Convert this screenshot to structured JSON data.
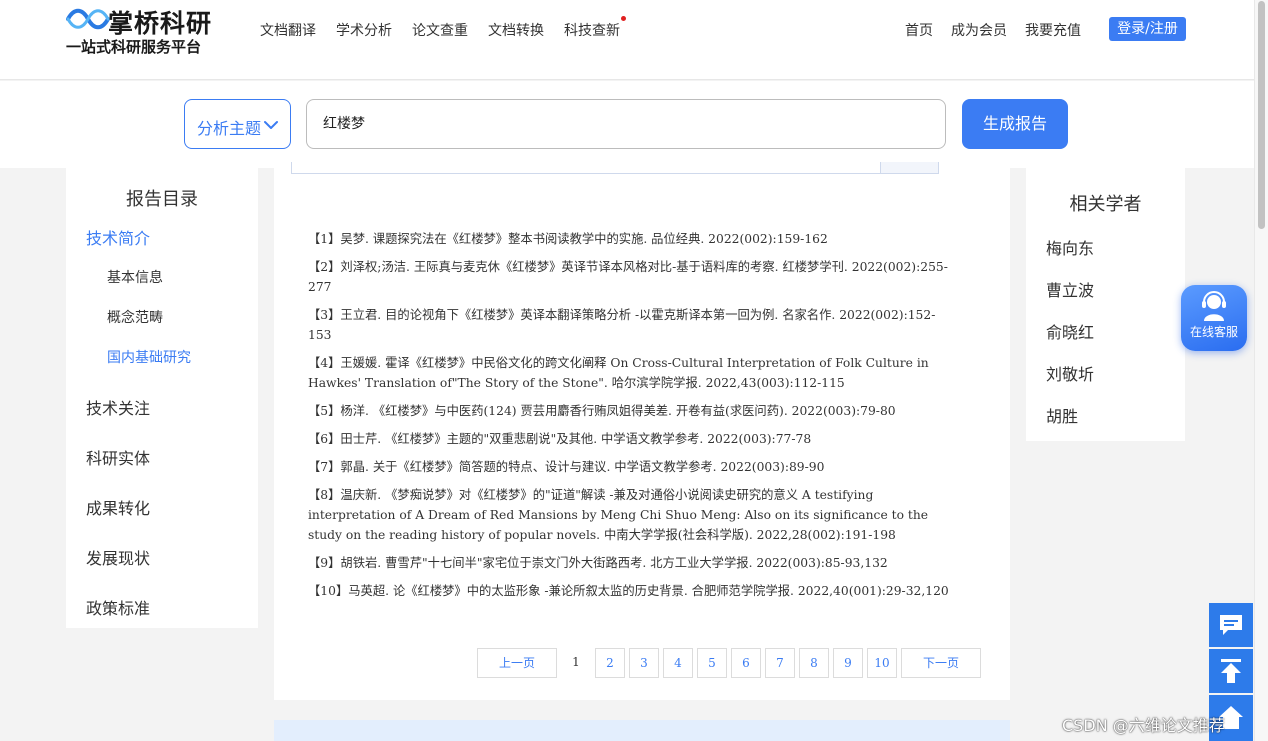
{
  "brand": {
    "name": "掌桥科研",
    "slogan": "一站式科研服务平台"
  },
  "nav": {
    "links": [
      "文档翻译",
      "学术分析",
      "论文查重",
      "文档转换",
      "科技查新"
    ],
    "right_links": [
      "首页",
      "成为会员",
      "我要充值"
    ],
    "login_label": "登录/注册"
  },
  "search": {
    "topic_label": "分析主题",
    "query": "红楼梦",
    "generate_label": "生成报告"
  },
  "toc": {
    "title": "报告目录",
    "items": [
      {
        "label": "技术简介",
        "level": 1,
        "active": true
      },
      {
        "label": "基本信息",
        "level": 2,
        "active": false
      },
      {
        "label": "概念范畴",
        "level": 2,
        "active": false
      },
      {
        "label": "国内基础研究",
        "level": 2,
        "active": true
      },
      {
        "label": "技术关注",
        "level": 1,
        "active": false
      },
      {
        "label": "科研实体",
        "level": 1,
        "active": false
      },
      {
        "label": "成果转化",
        "level": 1,
        "active": false
      },
      {
        "label": "发展现状",
        "level": 1,
        "active": false
      },
      {
        "label": "政策标准",
        "level": 1,
        "active": false
      }
    ]
  },
  "references": [
    "【1】吴梦. 课题探究法在《红楼梦》整本书阅读教学中的实施. 品位经典. 2022(002):159-162",
    "【2】刘泽权;汤洁. 王际真与麦克休《红楼梦》英译节译本风格对比-基于语料库的考察. 红楼梦学刊. 2022(002):255-277",
    "【3】王立君. 目的论视角下《红楼梦》英译本翻译策略分析 -以霍克斯译本第一回为例. 名家名作. 2022(002):152-153",
    "【4】王媛媛. 霍译《红楼梦》中民俗文化的跨文化阐释 On Cross-Cultural Interpretation of Folk Culture in Hawkes' Translation of\"The Story of the Stone\". 哈尔滨学院学报. 2022,43(003):112-115",
    "【5】杨洋. 《红楼梦》与中医药(124) 贾芸用麝香行贿凤姐得美差. 开卷有益(求医问药). 2022(003):79-80",
    "【6】田士芹. 《红楼梦》主题的\"双重悲剧说\"及其他. 中学语文教学参考. 2022(003):77-78",
    "【7】郭晶. 关于《红楼梦》简答题的特点、设计与建议. 中学语文教学参考. 2022(003):89-90",
    "【8】温庆新. 《梦痴说梦》对《红楼梦》的\"证道\"解读 -兼及对通俗小说阅读史研究的意义 A testifying interpretation of A Dream of Red Mansions by Meng Chi Shuo Meng: Also on its significance to the study on the reading history of popular novels. 中南大学学报(社会科学版). 2022,28(002):191-198",
    "【9】胡铁岩. 曹雪芹\"十七间半\"家宅位于崇文门外大街路西考. 北方工业大学学报. 2022(003):85-93,132",
    "【10】马英超. 论《红楼梦》中的太监形象 -兼论所叙太监的历史背景. 合肥师范学院学报. 2022,40(001):29-32,120"
  ],
  "pagination": {
    "prev_label": "上一页",
    "current": "1",
    "pages": [
      "2",
      "3",
      "4",
      "5",
      "6",
      "7",
      "8",
      "9",
      "10"
    ],
    "next_label": "下一页"
  },
  "scholars": {
    "title": "相关学者",
    "names": [
      "梅向东",
      "曹立波",
      "俞晓红",
      "刘敬圻",
      "胡胜"
    ]
  },
  "widgets": {
    "online_service_label": "在线客服"
  },
  "watermark": "CSDN @六维论文推荐",
  "colors": {
    "accent": "#3b7cf3",
    "float_button": "#2d7bea",
    "page_background": "#f3f3f3"
  }
}
